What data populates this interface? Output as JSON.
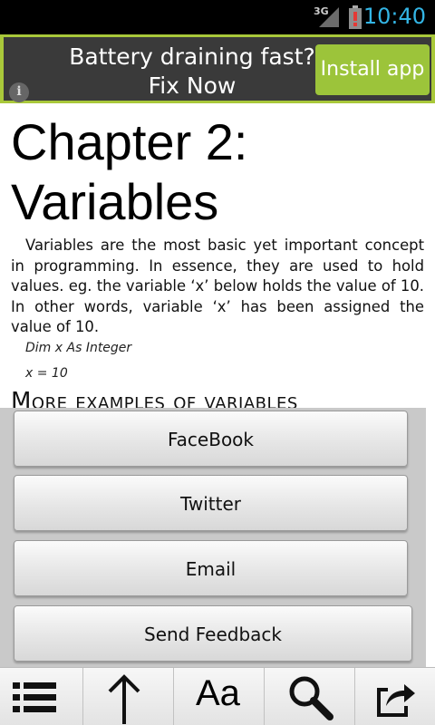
{
  "status_bar": {
    "network": "3G",
    "time": "10:40"
  },
  "ad": {
    "headline_line1": "Battery draining fast?",
    "headline_line2": "Fix Now",
    "install_label": "Install app",
    "info_label": "i"
  },
  "article": {
    "chapter_title_line1": "Chapter 2:",
    "chapter_title_line2": "Variables",
    "body": "Variables are the most basic yet important concept in programming. In essence, they are used to hold values. eg. the variable ‘x’ below holds the value of 10. In other words, variable ‘x’ has been assigned the value of 10.",
    "code_line_1": "Dim x As Integer",
    "code_line_2": "x = 10",
    "section_heading": "More examples of variables"
  },
  "share_menu": {
    "facebook_label": "FaceBook",
    "twitter_label": "Twitter",
    "email_label": "Email",
    "feedback_label": "Send Feedback"
  },
  "toolbar": {
    "font_label": "Aa",
    "icons": [
      "list-icon",
      "arrow-up-icon",
      "font-size-icon",
      "search-icon",
      "share-icon"
    ]
  }
}
